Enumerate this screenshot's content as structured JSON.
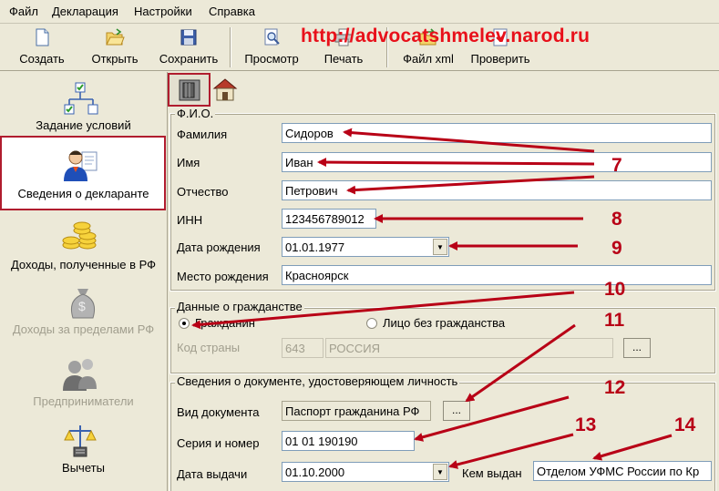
{
  "menu": {
    "file": "Файл",
    "declaration": "Декларация",
    "settings": "Настройки",
    "help": "Справка"
  },
  "toolbar": {
    "create": "Создать",
    "open": "Открыть",
    "save": "Сохранить",
    "preview": "Просмотр",
    "print": "Печать",
    "xml": "Файл xml",
    "check": "Проверить"
  },
  "watermark": "http://advocatshmelev.narod.ru",
  "sidebar": {
    "items": [
      {
        "label": "Задание условий",
        "icon": "tree-checklist-icon"
      },
      {
        "label": "Сведения о декларанте",
        "icon": "person-document-icon"
      },
      {
        "label": "Доходы, полученные в РФ",
        "icon": "coins-icon"
      },
      {
        "label": "Доходы за пределами РФ",
        "icon": "money-bag-icon"
      },
      {
        "label": "Предприниматели",
        "icon": "businessman-icon"
      },
      {
        "label": "Вычеты",
        "icon": "scales-icon"
      }
    ]
  },
  "fio": {
    "title": "Ф.И.О.",
    "surname_label": "Фамилия",
    "surname_value": "Сидоров",
    "name_label": "Имя",
    "name_value": "Иван",
    "patronymic_label": "Отчество",
    "patronymic_value": "Петрович",
    "inn_label": "ИНН",
    "inn_value": "123456789012",
    "birthdate_label": "Дата рождения",
    "birthdate_value": "01.01.1977",
    "birthplace_label": "Место рождения",
    "birthplace_value": "Красноярск"
  },
  "citizenship": {
    "title": "Данные о гражданстве",
    "citizen_label": "Гражданин",
    "stateless_label": "Лицо без гражданства",
    "selected": "citizen",
    "country_code_label": "Код страны",
    "country_code_value": "643",
    "country_name_value": "РОССИЯ",
    "ellipsis": "..."
  },
  "document": {
    "title": "Сведения о документе, удостоверяющем личность",
    "type_label": "Вид документа",
    "type_value": "Паспорт гражданина РФ",
    "ellipsis": "...",
    "series_label": "Серия и номер",
    "series_value": "01 01 190190",
    "issue_date_label": "Дата выдачи",
    "issue_date_value": "01.10.2000",
    "issued_by_label": "Кем выдан",
    "issued_by_value": "Отделом УФМС России по Кр"
  },
  "annotations": [
    "7",
    "8",
    "9",
    "10",
    "11",
    "12",
    "13",
    "14"
  ],
  "colors": {
    "annotation_red": "#b80016",
    "watermark_red": "#e8101a",
    "selection_border": "#b01c2e",
    "window_bg": "#ece9d8"
  }
}
